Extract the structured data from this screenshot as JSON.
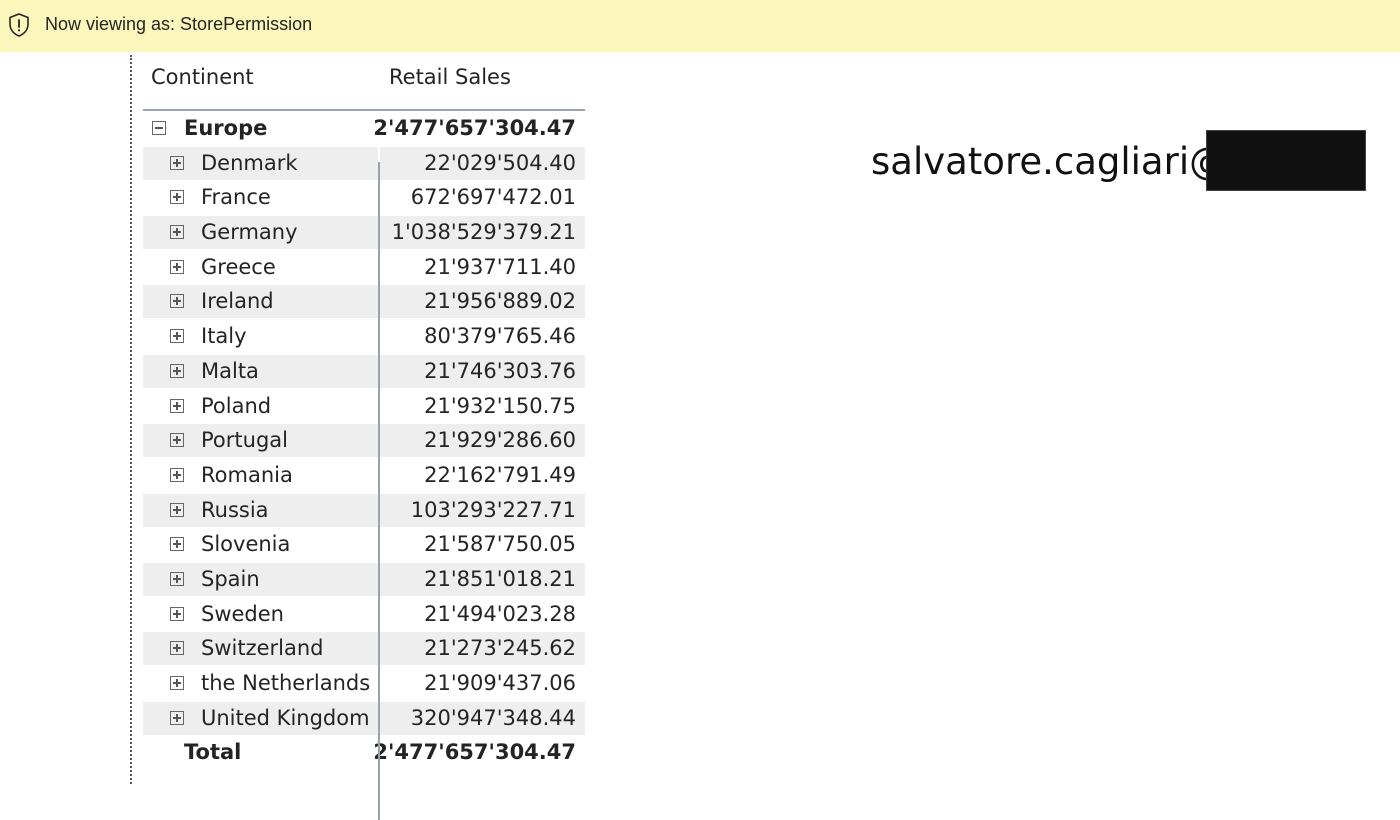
{
  "banner": {
    "text": "Now viewing as: StorePermission",
    "icon": "shield-icon",
    "background_color": "#fbf6bb"
  },
  "matrix": {
    "headers": {
      "col1": "Continent",
      "col2": "Retail Sales"
    },
    "group": {
      "label": "Europe",
      "value": "2'477'657'304.47",
      "expanded": true
    },
    "rows": [
      {
        "label": "Denmark",
        "value": "22'029'504.40"
      },
      {
        "label": "France",
        "value": "672'697'472.01"
      },
      {
        "label": "Germany",
        "value": "1'038'529'379.21"
      },
      {
        "label": "Greece",
        "value": "21'937'711.40"
      },
      {
        "label": "Ireland",
        "value": "21'956'889.02"
      },
      {
        "label": "Italy",
        "value": "80'379'765.46"
      },
      {
        "label": "Malta",
        "value": "21'746'303.76"
      },
      {
        "label": "Poland",
        "value": "21'932'150.75"
      },
      {
        "label": "Portugal",
        "value": "21'929'286.60"
      },
      {
        "label": "Romania",
        "value": "22'162'791.49"
      },
      {
        "label": "Russia",
        "value": "103'293'227.71"
      },
      {
        "label": "Slovenia",
        "value": "21'587'750.05"
      },
      {
        "label": "Spain",
        "value": "21'851'018.21"
      },
      {
        "label": "Sweden",
        "value": "21'494'023.28"
      },
      {
        "label": "Switzerland",
        "value": "21'273'245.62"
      },
      {
        "label": "the Netherlands",
        "value": "21'909'437.06"
      },
      {
        "label": "United Kingdom",
        "value": "320'947'348.44"
      }
    ],
    "total": {
      "label": "Total",
      "value": "2'477'657'304.47"
    }
  },
  "user_card": {
    "text": "salvatore.cagliari@"
  }
}
